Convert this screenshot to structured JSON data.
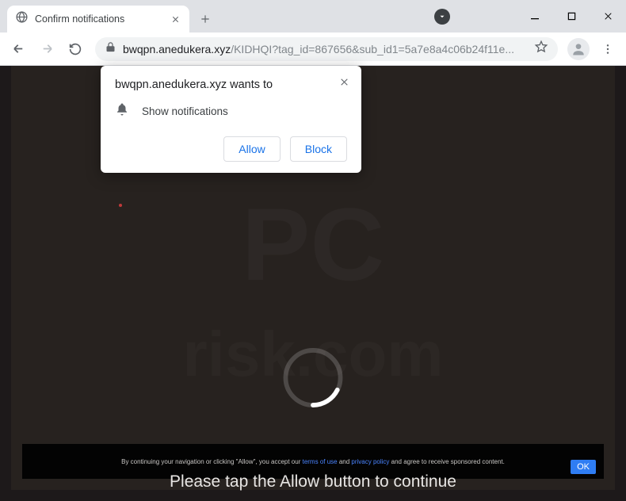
{
  "tab": {
    "title": "Confirm notifications"
  },
  "url": {
    "host": "bwqpn.anedukera.xyz",
    "path": "/KIDHQI?tag_id=867656&sub_id1=5a7e8a4c06b24f11e..."
  },
  "prompt": {
    "origin": "bwqpn.anedukera.xyz wants to",
    "permission": "Show notifications",
    "allow": "Allow",
    "block": "Block"
  },
  "page": {
    "cta": "Please tap the Allow button to continue",
    "fineprint_a": "By continuing your navigation or clicking \"Allow\", you accept our ",
    "fineprint_link1": "terms of use",
    "fineprint_b": " and ",
    "fineprint_link2": "privacy policy",
    "fineprint_c": " and agree to receive sponsored content.",
    "ok": "OK"
  }
}
